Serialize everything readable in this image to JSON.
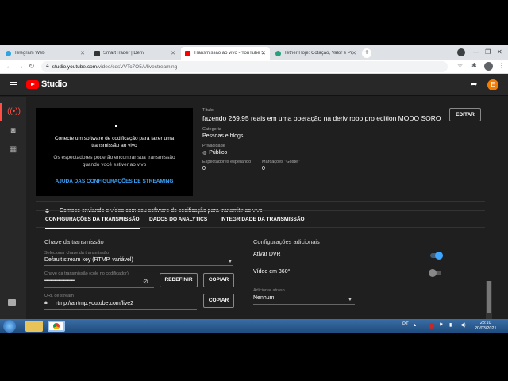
{
  "browser": {
    "tabs": [
      {
        "label": "Telegram Web",
        "color": "#2ca5e0"
      },
      {
        "label": "SmartTrader | Deriv",
        "color": "#333333"
      },
      {
        "label": "Transmissão ao vivo - YouTube S",
        "color": "#ff0000"
      },
      {
        "label": "Tether Hoje: Cotação, Valor e Pr",
        "color": "#26a17b"
      }
    ],
    "url_host": "studio.youtube.com",
    "url_path": "/video/cqsVVTc7O5A/livestreaming"
  },
  "studio": {
    "logo_text": "Studio",
    "avatar_letter": "E"
  },
  "preview": {
    "line1a": "Conecte um software de codificação para fazer uma",
    "line1b": "transmissão ao vivo",
    "line2a": "Os espectadores poderão encontrar sua transmissão",
    "line2b": "quando você estiver ao vivo",
    "help_link": "AJUDA DAS CONFIGURAÇÕES DE STREAMING"
  },
  "details": {
    "title_label": "Título",
    "title_value": "fazendo 269,95 reais em uma operação na deriv robo pro edition MODO SORO...",
    "category_label": "Categoria",
    "category_value": "Pessoas e blogs",
    "privacy_label": "Privacidade",
    "privacy_value": "Público",
    "waiting_label": "Espectadores esperando",
    "waiting_value": "0",
    "likes_label": "Marcações \"Gostei\"",
    "likes_value": "0",
    "edit_button": "EDITAR"
  },
  "status_message": "Comece enviando o vídeo com seu software de codificação para transmitir ao vivo",
  "content_tabs": [
    {
      "label": "CONFIGURAÇÕES DA TRANSMISSÃO"
    },
    {
      "label": "DADOS DO ANALYTICS"
    },
    {
      "label": "INTEGRIDADE DA TRANSMISSÃO"
    }
  ],
  "stream_settings": {
    "section_title": "Chave da transmissão",
    "key_select_label": "Selecionar chave da transmissão",
    "key_select_value": "Default stream key (RTMP, variável)",
    "key_field_label": "Chave da transmissão (cole no codificador)",
    "key_field_value": "••••••••••••••••••••••••••••••",
    "reset_button": "REDEFINIR",
    "copy_button": "COPIAR",
    "url_label": "URL de stream",
    "url_value": "rtmp://a.rtmp.youtube.com/live2",
    "copy_url_button": "COPIAR"
  },
  "additional_settings": {
    "section_title": "Configurações adicionais",
    "dvr_label": "Ativar DVR",
    "dvr_on": true,
    "video360_label": "Vídeo em 360°",
    "video360_on": false,
    "delay_label": "Adicionar atraso",
    "delay_value": "Nenhum"
  },
  "taskbar": {
    "lang": "PT",
    "time": "23:10",
    "date": "20/03/2021"
  },
  "colors": {
    "accent_blue": "#3ea6ff",
    "live_red": "#ff4e45",
    "toggle_on": "#3ea6ff"
  }
}
